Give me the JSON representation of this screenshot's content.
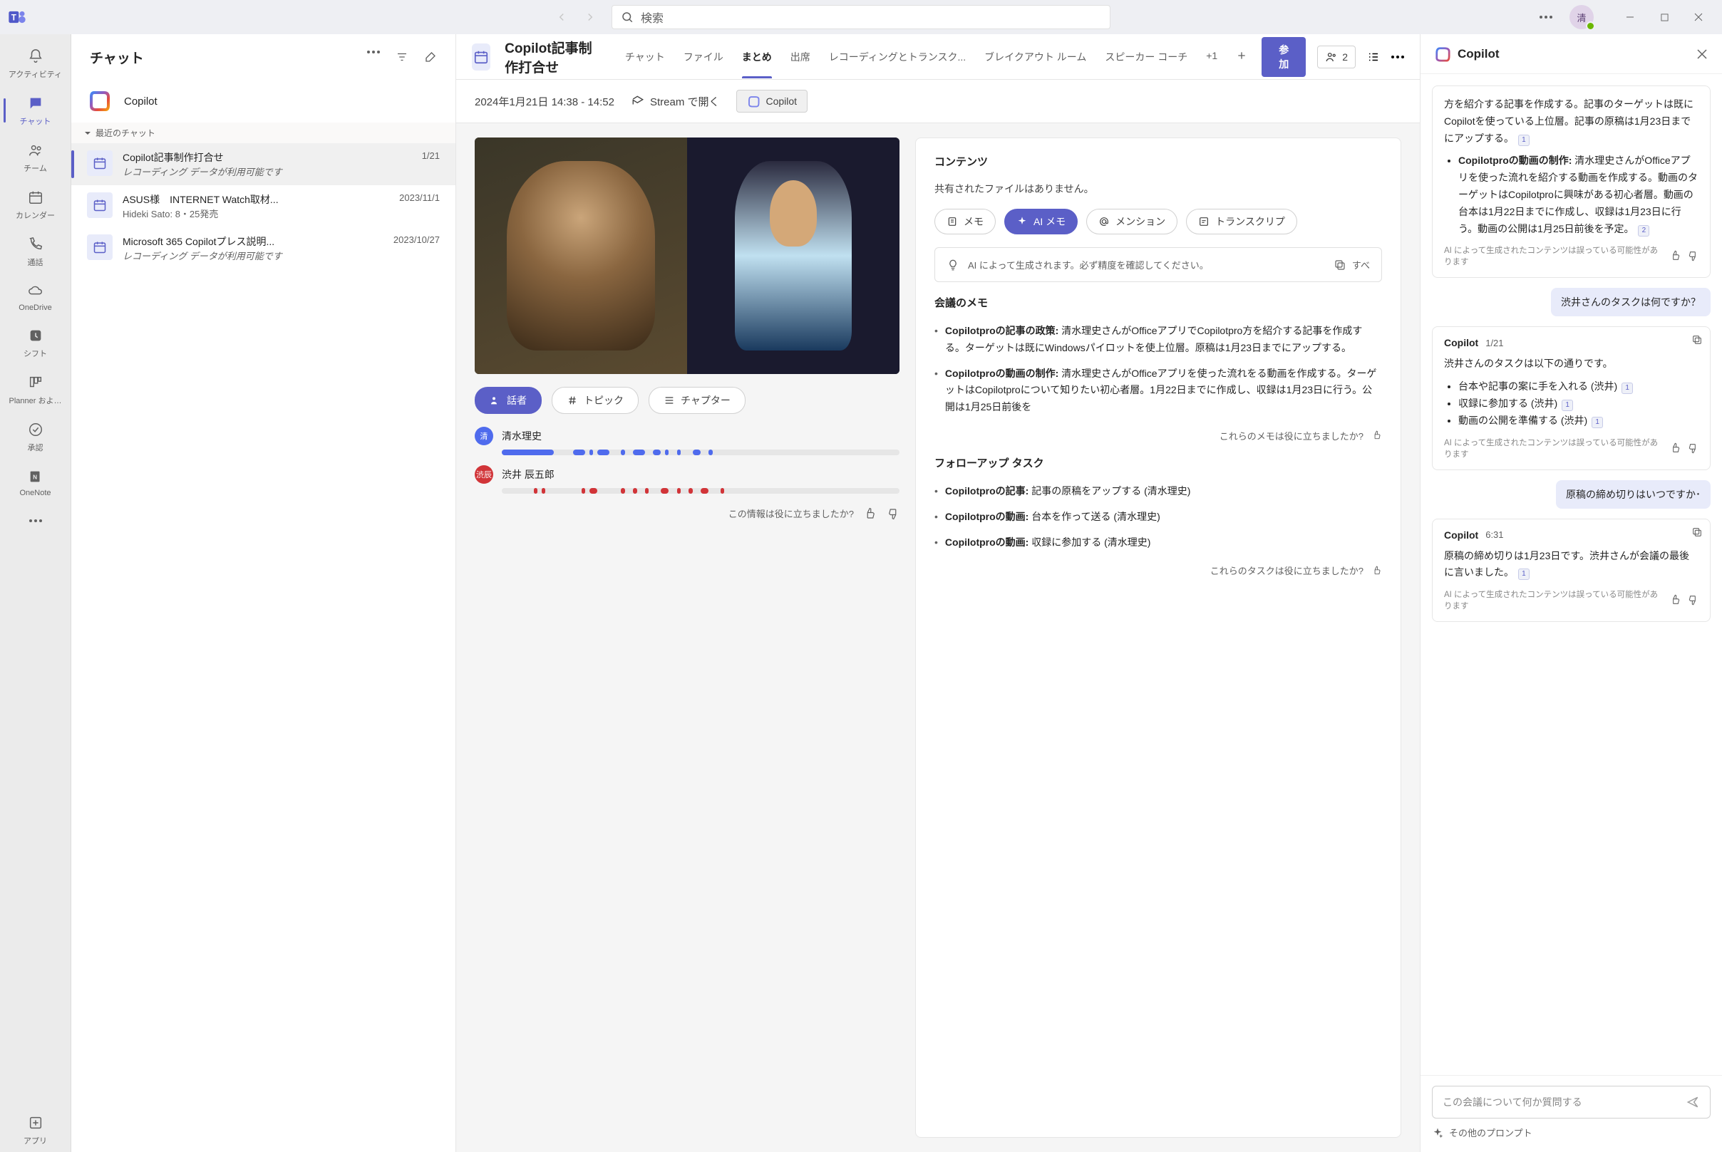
{
  "titlebar": {
    "search_placeholder": "検索",
    "user_initial": "清"
  },
  "rail": {
    "items": [
      {
        "label": "アクティビティ"
      },
      {
        "label": "チャット"
      },
      {
        "label": "チーム"
      },
      {
        "label": "カレンダー"
      },
      {
        "label": "通話"
      },
      {
        "label": "OneDrive"
      },
      {
        "label": "シフト"
      },
      {
        "label": "Planner およ…"
      },
      {
        "label": "承認"
      },
      {
        "label": "OneNote"
      }
    ],
    "apps_label": "アプリ"
  },
  "chat_list": {
    "title": "チャット",
    "copilot_label": "Copilot",
    "recent_label": "最近のチャット",
    "items": [
      {
        "title": "Copilot記事制作打合せ",
        "sub": "レコーディング データが利用可能です",
        "date": "1/21",
        "italic": true
      },
      {
        "title": "ASUS様　INTERNET Watch取材...",
        "sub": "Hideki Sato: 8・25発売",
        "date": "2023/11/1",
        "italic": false
      },
      {
        "title": "Microsoft 365 Copilotプレス説明...",
        "sub": "レコーディング データが利用可能です",
        "date": "2023/10/27",
        "italic": true
      }
    ]
  },
  "meeting": {
    "title": "Copilot記事制作打合せ",
    "tabs": [
      "チャット",
      "ファイル",
      "まとめ",
      "出席",
      "レコーディングとトランスク...",
      "ブレイクアウト ルーム",
      "スピーカー コーチ",
      "+1"
    ],
    "active_tab_index": 2,
    "join_label": "参加",
    "participants": "2",
    "timestamp": "2024年1月21日  14:38 - 14:52",
    "stream_label": "Stream で開く",
    "copilot_chip": "Copilot"
  },
  "recap": {
    "view_tabs": {
      "speaker": "話者",
      "topic": "トピック",
      "chapter": "チャプター"
    },
    "speakers": [
      {
        "name": "清水理史",
        "initial": "清",
        "color": "blue"
      },
      {
        "name": "渋井 辰五郎",
        "initial": "渋辰",
        "color": "red"
      }
    ],
    "helpful": "この情報は役に立ちましたか?"
  },
  "content": {
    "contents_title": "コンテンツ",
    "contents_body": "共有されたファイルはありません。",
    "pills": {
      "memo": "メモ",
      "ai_memo": "AI メモ",
      "mention": "メンション",
      "transcript": "トランスクリプ"
    },
    "gen_note": "AI によって生成されます。必ず精度を確認してください。",
    "gen_action": "すべ",
    "memo_title": "会議のメモ",
    "memo_items": [
      {
        "b": "Copilotproの記事の政策:",
        "t": " 清水理史さんがOfficeアプリでCopilotpro方を紹介する記事を作成する。ターゲットは既にWindowsパイロットを使上位層。原稿は1月23日までにアップする。"
      },
      {
        "b": "Copilotproの動画の制作:",
        "t": " 清水理史さんがOfficeアプリを使った流れをる動画を作成する。ターゲットはCopilotproについて知りたい初心者層。1月22日までに作成し、収録は1月23日に行う。公開は1月25日前後を"
      }
    ],
    "memo_feedback": "これらのメモは役に立ちましたか?",
    "followup_title": "フォローアップ タスク",
    "followup_items": [
      {
        "b": "Copilotproの記事:",
        "t": " 記事の原稿をアップする (清水理史)"
      },
      {
        "b": "Copilotproの動画:",
        "t": " 台本を作って送る (清水理史)"
      },
      {
        "b": "Copilotproの動画:",
        "t": " 収録に参加する (清水理史)"
      }
    ],
    "followup_feedback": "これらのタスクは役に立ちましたか?"
  },
  "copilot": {
    "title": "Copilot",
    "disclaimer": "AI によって生成されたコンテンツは誤っている可能性があります",
    "top_fragment": "方を紹介する記事を作成する。記事のターゲットは既にCopilotを使っている上位層。記事の原稿は1月23日までにアップする。",
    "top_ref": "1",
    "top_item_b": "Copilotproの動画の制作:",
    "top_item_t": " 清水理史さんがOfficeアプリを使った流れを紹介する動画を作成する。動画のターゲットはCopilotproに興味がある初心者層。動画の台本は1月22日までに作成し、収録は1月23日に行う。動画の公開は1月25日前後を予定。",
    "top_ref2": "2",
    "user_q1": "渋井さんのタスクは何ですか？",
    "card2": {
      "who": "Copilot",
      "when": "1/21",
      "lead": "渋井さんのタスクは以下の通りです。",
      "items": [
        {
          "t": "台本や記事の案に手を入れる (渋井)",
          "ref": "1"
        },
        {
          "t": "収録に参加する (渋井)",
          "ref": "1"
        },
        {
          "t": "動画の公開を準備する (渋井)",
          "ref": "1"
        }
      ]
    },
    "user_q2": "原稿の締め切りはいつですか･",
    "card3": {
      "who": "Copilot",
      "when": "6:31",
      "body": "原稿の締め切りは1月23日です。渋井さんが会議の最後に言いました。",
      "ref": "1"
    },
    "input_placeholder": "この会議について何か質問する",
    "other_prompts": "その他のプロンプト"
  }
}
